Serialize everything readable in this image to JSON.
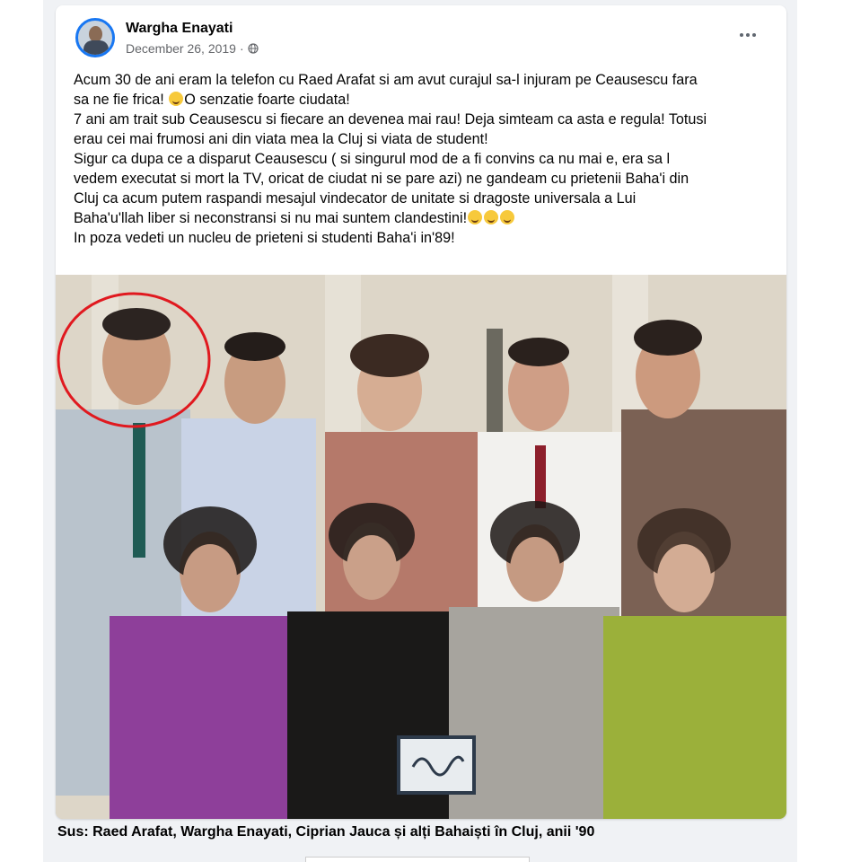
{
  "post": {
    "author": "Wargha Enayati",
    "date": "December 26, 2019",
    "date_separator": "·",
    "privacy_icon": "globe-icon",
    "more_icon": "more-options-icon",
    "text_lines": [
      "Acum 30 de ani eram la telefon  cu Raed Arafat si am avut curajul sa-l injuram pe Ceausescu fara",
      "sa ne fie frica!",
      "O senzatie foarte ciudata!",
      "7 ani am trait sub Ceausescu si fiecare an devenea mai rau! Deja simteam ca asta e regula! Totusi",
      "erau cei mai frumosi ani din viata mea la Cluj si viata de student!",
      "Sigur ca dupa ce a disparut Ceausescu ( si singurul mod de a fi convins ca nu mai e, era sa l",
      "vedem executat si mort la TV, oricat de ciudat ni se pare azi) ne gandeam cu prietenii Baha'i din",
      "Cluj ca acum putem raspandi mesajul vindecator de unitate si dragoste universala a Lui",
      "Baha'u'llah liber si neconstransi si nu mai suntem clandestini!",
      "In poza vedeti un nucleu de prieteni si studenti Baha'i in'89!"
    ],
    "photo_alt_icon": "group-photo-image",
    "highlight_icon": "red-circle-highlight-icon"
  },
  "caption": "Sus: Raed Arafat, Wargha Enayati, Ciprian Jauca și alți Bahaiști în Cluj, anii '90",
  "colors": {
    "accent_blue": "#1877f2",
    "highlight_red": "#e0191f",
    "meta_gray": "#65676b"
  }
}
